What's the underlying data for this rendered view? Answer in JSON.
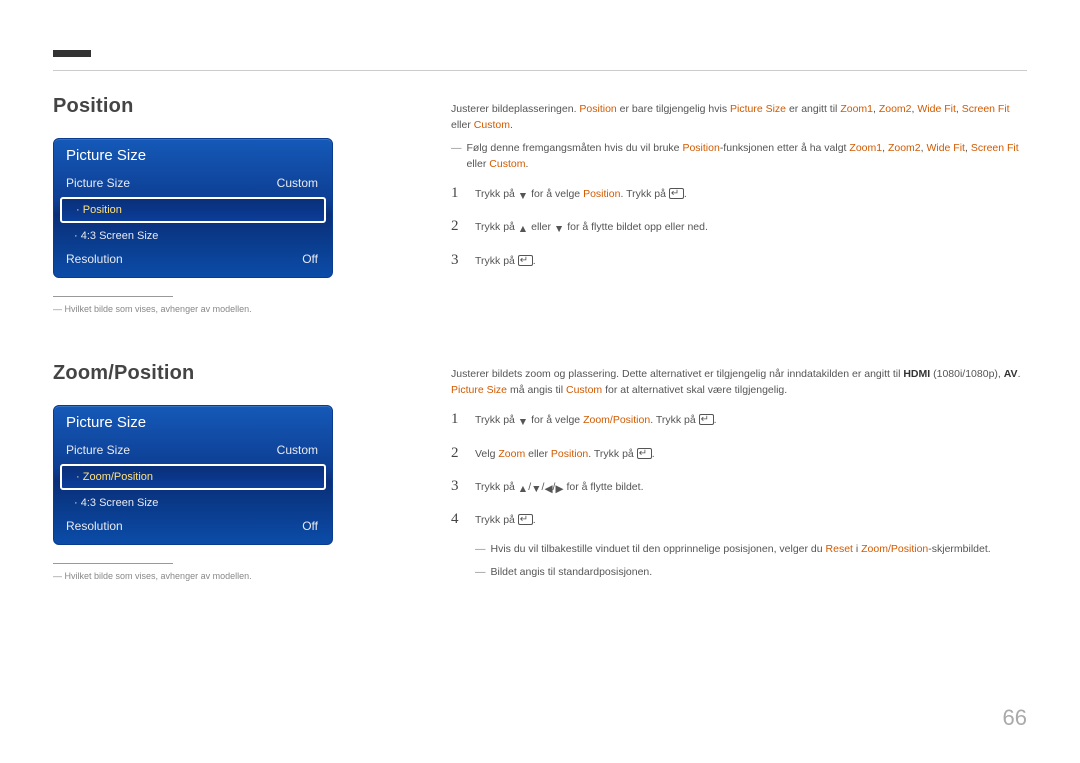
{
  "page_number": "66",
  "section1": {
    "heading": "Position",
    "osd_title": "Picture Size",
    "row1_label": "Picture Size",
    "row1_value": "Custom",
    "sel": "Position",
    "sub2": "4:3 Screen Size",
    "row3_label": "Resolution",
    "row3_value": "Off",
    "caption": "Hvilket bilde som vises, avhenger av modellen.",
    "body_intro_a": "Justerer bildeplasseringen. ",
    "body_intro_b": " er bare tilgjengelig hvis ",
    "body_intro_c": " er angitt til ",
    "body_intro_d": " eller ",
    "kw_position": "Position",
    "kw_picsize": "Picture Size",
    "kw_zoom1": "Zoom1",
    "kw_zoom2": "Zoom2",
    "kw_widefit": "Wide Fit",
    "kw_screenfit": "Screen Fit",
    "kw_custom": "Custom",
    "note1_a": "Følg denne fremgangsmåten hvis du vil bruke ",
    "note1_b": "-funksjonen etter å ha valgt ",
    "note1_c": " eller ",
    "steps": {
      "s1a": "Trykk på ",
      "s1b": " for å velge ",
      "s1c": ". Trykk på ",
      "s1d": ".",
      "s2a": "Trykk på ",
      "s2b": " eller ",
      "s2c": " for å flytte bildet opp eller ned.",
      "s3a": "Trykk på ",
      "s3b": "."
    }
  },
  "section2": {
    "heading": "Zoom/Position",
    "osd_title": "Picture Size",
    "row1_label": "Picture Size",
    "row1_value": "Custom",
    "sel": "Zoom/Position",
    "sub2": "4:3 Screen Size",
    "row3_label": "Resolution",
    "row3_value": "Off",
    "caption": "Hvilket bilde som vises, avhenger av modellen.",
    "body_a": "Justerer bildets zoom og plassering. Dette alternativet er tilgjengelig når inndatakilden er angitt til ",
    "kw_hdmi": "HDMI",
    "body_b": " (1080i/1080p), ",
    "kw_av": "AV",
    "body_c": ". ",
    "kw_picsize": "Picture Size",
    "body_d": " må angis til ",
    "kw_custom": "Custom",
    "body_e": " for at alternativet skal være tilgjengelig.",
    "kw_zoompos": "Zoom/Position",
    "kw_zoom": "Zoom",
    "kw_position": "Position",
    "kw_reset": "Reset",
    "steps": {
      "s1a": "Trykk på ",
      "s1b": " for å velge ",
      "s1c": ". Trykk på ",
      "s2a": "Velg ",
      "s2b": " eller ",
      "s2c": ". Trykk på ",
      "s3a": "Trykk på ",
      "s3b": " for å flytte bildet.",
      "s4a": "Trykk på "
    },
    "note_reset_a": "Hvis du vil tilbakestille vinduet til den opprinnelige posisjonen, velger du ",
    "note_reset_b": " i ",
    "note_reset_c": "-skjermbildet.",
    "note_default": "Bildet angis til standardposisjonen."
  }
}
